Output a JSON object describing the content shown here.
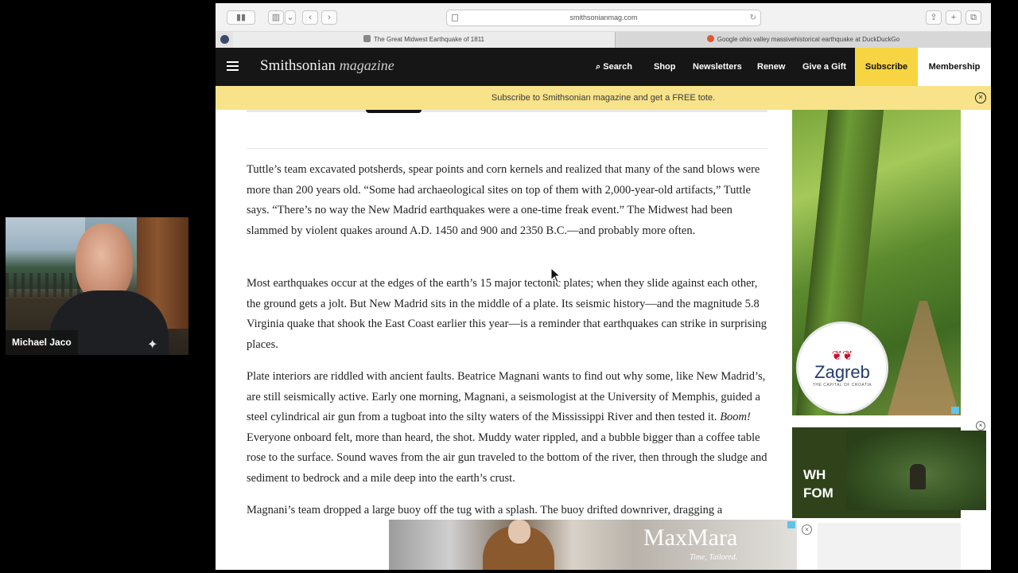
{
  "webcam": {
    "name": "Michael Jaco",
    "logo_icon": "eagle-logo-icon"
  },
  "browser": {
    "url": "smithsonianmag.com",
    "tabs": [
      {
        "title": "The Great Midwest Earthquake of 1811",
        "active": true,
        "favicon": "smithsonian-favicon"
      },
      {
        "title": "Google ohio valley massivehistorical earthquake at DuckDuckGo",
        "active": false,
        "favicon": "duckduckgo-favicon"
      }
    ]
  },
  "site": {
    "logo": "Smithsonian",
    "logo_suffix": "magazine",
    "nav": {
      "search": "Search",
      "shop": "Shop",
      "newsletters": "Newsletters",
      "renew": "Renew",
      "give_gift": "Give a Gift",
      "subscribe": "Subscribe",
      "membership": "Membership"
    },
    "promo": "Subscribe to Smithsonian magazine and get a FREE tote."
  },
  "article": {
    "paragraphs": [
      "Tuttle’s team excavated potsherds, spear points and corn kernels and realized that many of the sand blows were more than 200 years old. “Some had archaeological sites on top of them with 2,000-year-old artifacts,” Tuttle says. “There’s no way the New Madrid earthquakes were a one-time freak event.” The Midwest had been slammed by violent quakes around A.D. 1450 and 900 and 2350 B.C.—and probably more often.",
      "Most earthquakes occur at the edges of the earth’s 15 major tectonic plates; when they slide against each other, the ground gets a jolt. But New Madrid sits in the middle of a plate. Its seismic history—and the magnitude 5.8 Virginia quake that shook the East Coast earlier this year—is a reminder that earthquakes can strike in surprising places.",
      "Plate interiors are riddled with ancient faults. Beatrice Magnani wants to find out why some, like New Madrid’s, are still seismically active. Early one morning, Magnani, a seismologist at the University of Memphis, guided a steel cylindrical air gun from a tugboat into the silty waters of the Mississippi River and then tested it. Boom! Everyone onboard felt, more than heard, the shot. Muddy water rippled, and a bubble bigger than a coffee table rose to the surface. Sound waves from the air gun traveled to the bottom of the river, then through the sludge and sediment to bedrock and a mile deep into the earth’s crust.",
      "Magnani’s team dropped a large buoy off the tug with a splash. The buoy drifted downriver, dragging a"
    ]
  },
  "ads": {
    "zagreb": {
      "brand": "Zagreb",
      "caption": "THE CAPITAL OF CROATIA"
    },
    "video_ad": {
      "text_line1": "WH",
      "text_line2": "FOM"
    },
    "maxmara": {
      "brand": "MaxMara",
      "tagline": "Time, Tailored."
    }
  }
}
